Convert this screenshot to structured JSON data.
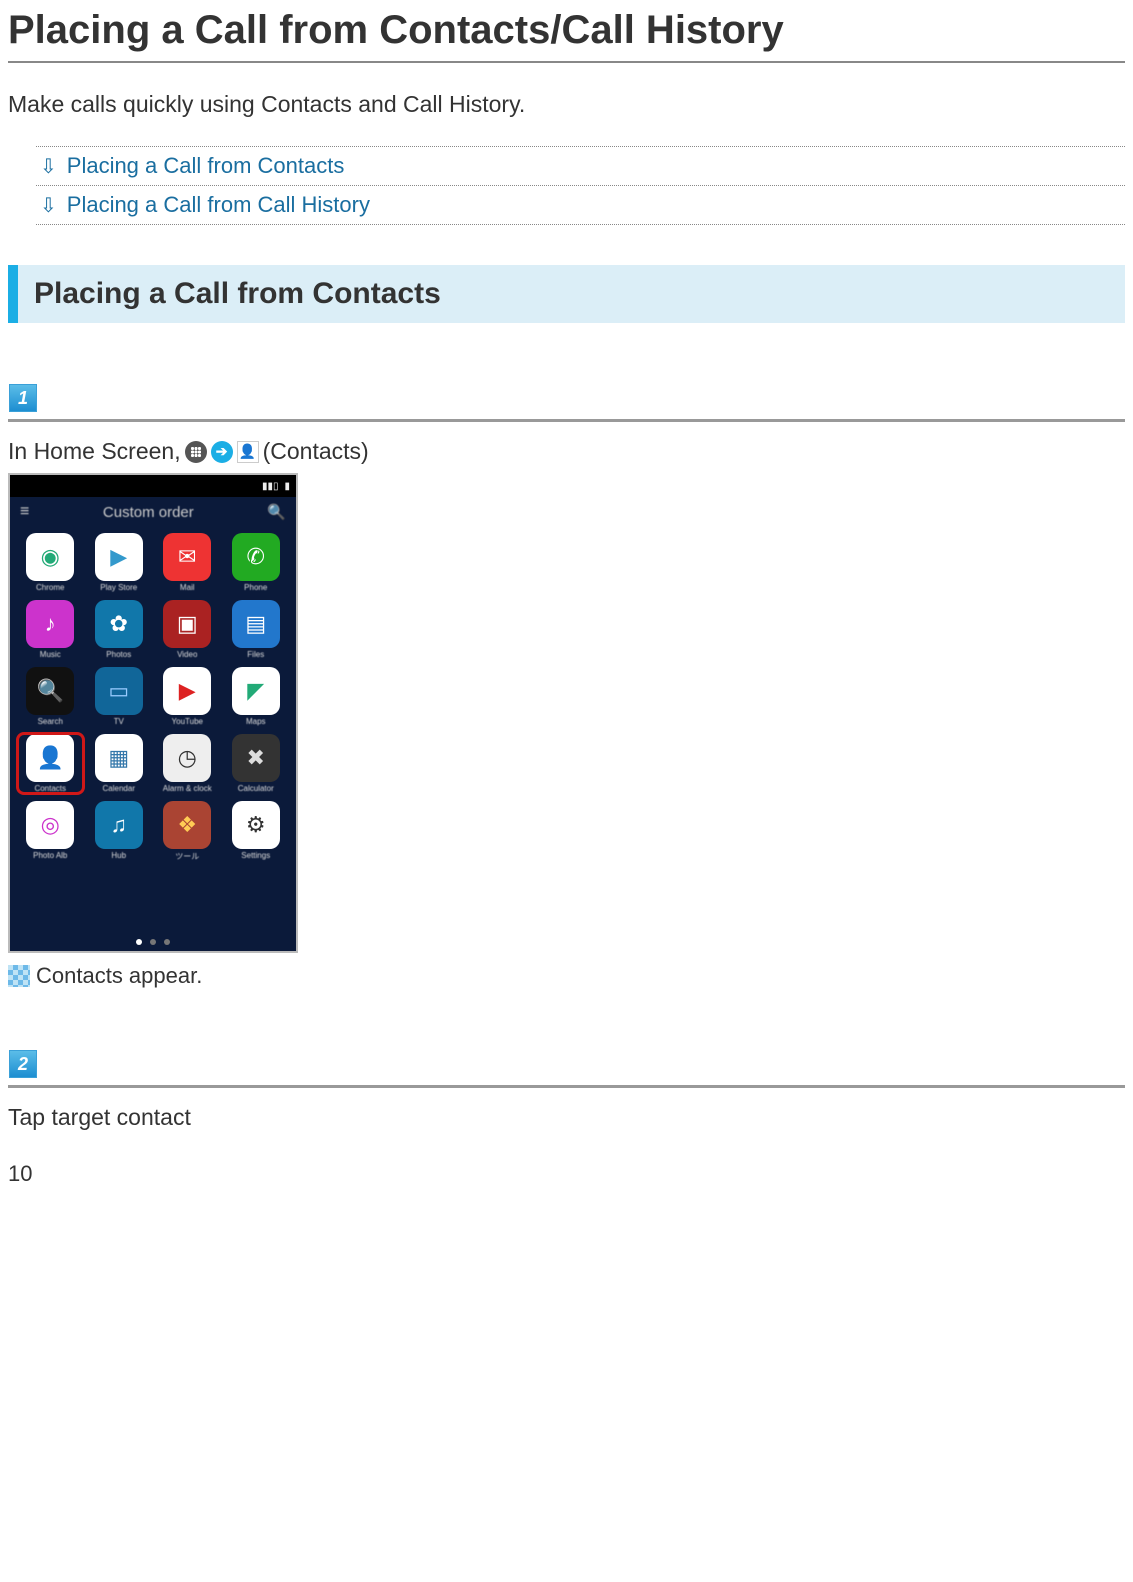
{
  "page": {
    "title": "Placing a Call from Contacts/Call History",
    "intro": "Make calls quickly using Contacts and Call History.",
    "number": "10"
  },
  "toc": {
    "items": [
      {
        "label": "Placing a Call from Contacts"
      },
      {
        "label": "Placing a Call from Call History"
      }
    ]
  },
  "section": {
    "heading": "Placing a Call from Contacts"
  },
  "steps": [
    {
      "num": "1",
      "text_before": "In Home Screen, ",
      "text_after": " (Contacts)",
      "result": "Contacts appear."
    },
    {
      "num": "2",
      "text": "Tap target contact"
    }
  ],
  "phone": {
    "header_title": "Custom order",
    "apps": [
      {
        "label": "Chrome",
        "bg": "#fff",
        "glyph": "◉",
        "fg": "#2a7"
      },
      {
        "label": "Play Store",
        "bg": "#fff",
        "glyph": "▶",
        "fg": "#39c"
      },
      {
        "label": "Mail",
        "bg": "#e33",
        "glyph": "✉",
        "fg": "#fff"
      },
      {
        "label": "Phone",
        "bg": "#2a2",
        "glyph": "✆",
        "fg": "#fff"
      },
      {
        "label": "Music",
        "bg": "#c3c",
        "glyph": "♪",
        "fg": "#fff"
      },
      {
        "label": "Photos",
        "bg": "#17a",
        "glyph": "✿",
        "fg": "#fff"
      },
      {
        "label": "Video",
        "bg": "#a22",
        "glyph": "▣",
        "fg": "#fff"
      },
      {
        "label": "Files",
        "bg": "#27c",
        "glyph": "▤",
        "fg": "#fff"
      },
      {
        "label": "Search",
        "bg": "#111",
        "glyph": "🔍",
        "fg": "#fff"
      },
      {
        "label": "TV",
        "bg": "#169",
        "glyph": "▭",
        "fg": "#9cf"
      },
      {
        "label": "YouTube",
        "bg": "#fff",
        "glyph": "▶",
        "fg": "#d22"
      },
      {
        "label": "Maps",
        "bg": "#fff",
        "glyph": "◤",
        "fg": "#2a7"
      },
      {
        "label": "Contacts",
        "bg": "#fff",
        "glyph": "👤",
        "fg": "#c44",
        "highlight": true
      },
      {
        "label": "Calendar",
        "bg": "#fff",
        "glyph": "▦",
        "fg": "#37a"
      },
      {
        "label": "Alarm & clock",
        "bg": "#eee",
        "glyph": "◷",
        "fg": "#333"
      },
      {
        "label": "Calculator",
        "bg": "#333",
        "glyph": "✖",
        "fg": "#ddd"
      },
      {
        "label": "Photo Alb",
        "bg": "#fff",
        "glyph": "◎",
        "fg": "#c3c"
      },
      {
        "label": "Hub",
        "bg": "#17a",
        "glyph": "♫",
        "fg": "#fff"
      },
      {
        "label": "ツール",
        "bg": "#a43",
        "glyph": "❖",
        "fg": "#fc5"
      },
      {
        "label": "Settings",
        "bg": "#fff",
        "glyph": "⚙",
        "fg": "#333"
      }
    ]
  }
}
